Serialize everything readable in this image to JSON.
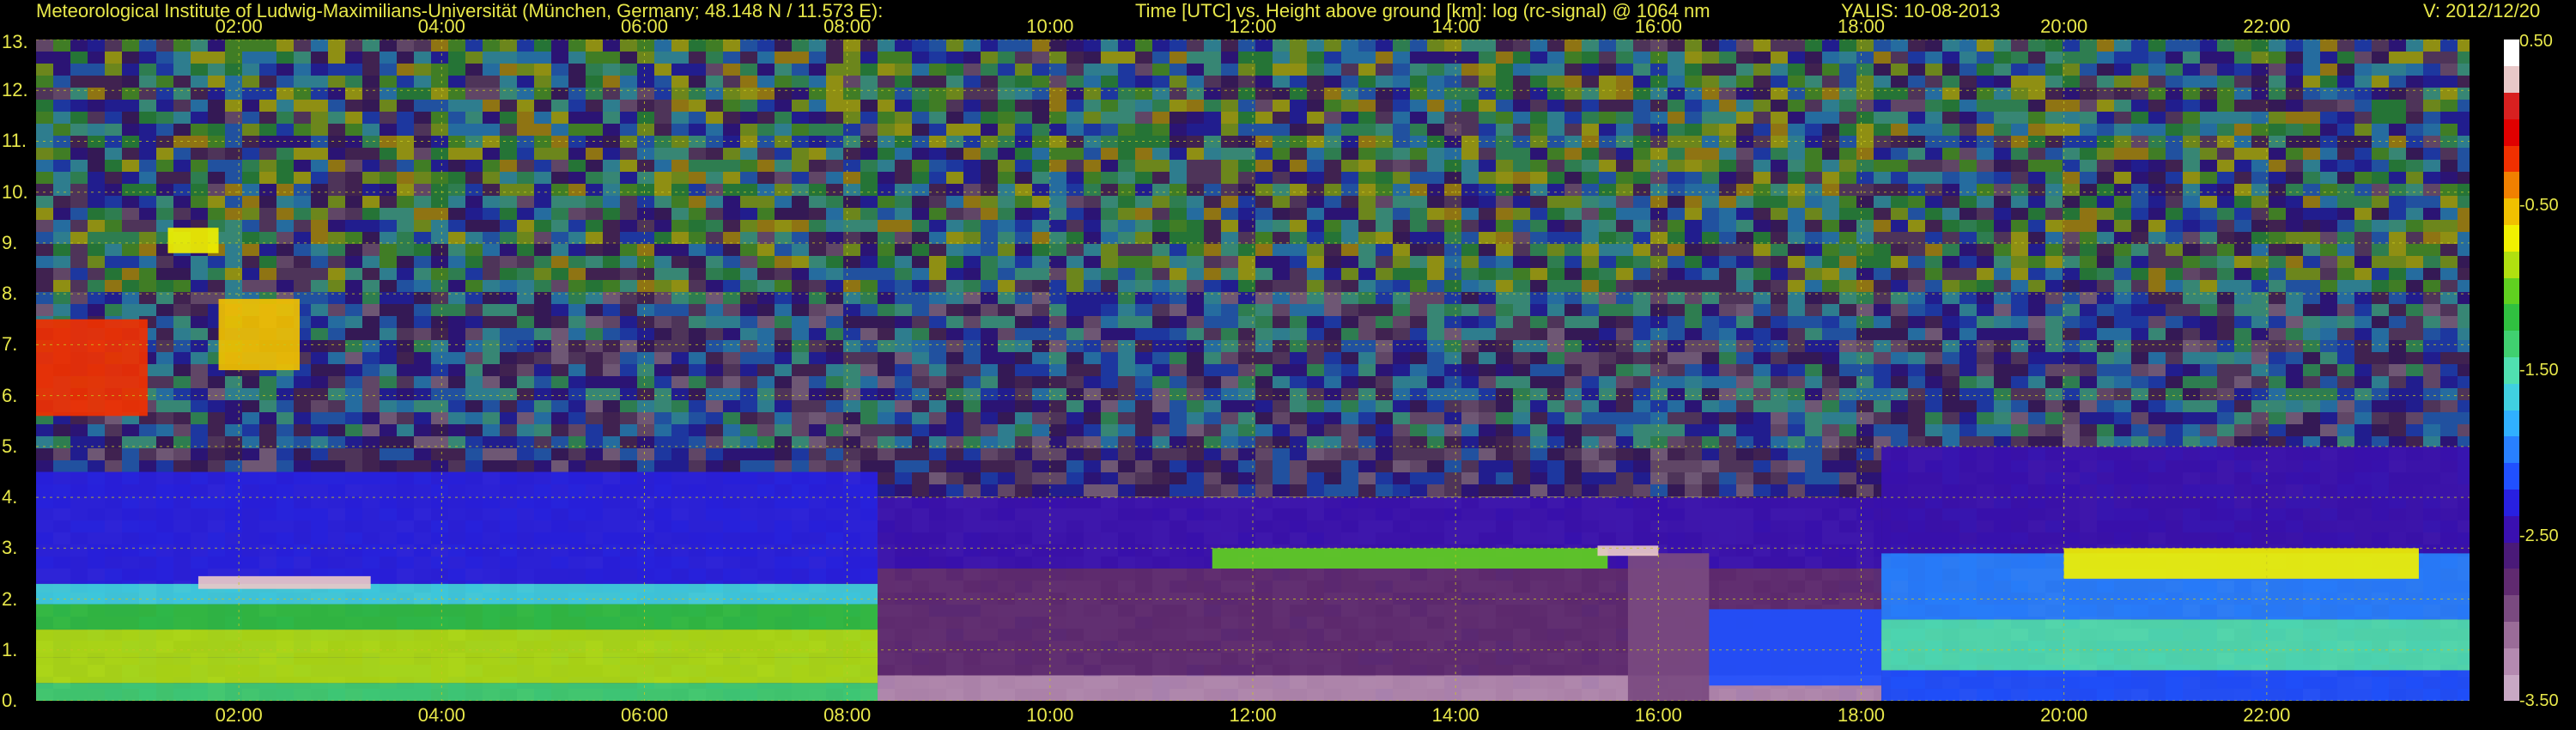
{
  "header": {
    "left": "Meteorological Institute of Ludwig-Maximilians-Universität (München, Germany; 48.148 N / 11.573 E):",
    "center": "Time [UTC] vs. Height above ground [km]: log (rc-signal) @ 1064 nm",
    "instrument": "YALIS: 10-08-2013",
    "version": "V: 2012/12/20"
  },
  "colors": {
    "text": "#e8e84a",
    "grid": "#c8c820",
    "background": "#000000"
  },
  "chart_data": {
    "type": "heatmap",
    "title": "Time [UTC] vs. Height above ground [km]: log (rc-signal) @ 1064 nm",
    "xlabel": "Time [UTC]",
    "ylabel": "Height above ground [km]",
    "xlim": [
      0,
      24
    ],
    "ylim": [
      0,
      13
    ],
    "grid": true,
    "x_ticks": [
      {
        "hour": 2,
        "label": "02:00"
      },
      {
        "hour": 4,
        "label": "04:00"
      },
      {
        "hour": 6,
        "label": "06:00"
      },
      {
        "hour": 8,
        "label": "08:00"
      },
      {
        "hour": 10,
        "label": "10:00"
      },
      {
        "hour": 12,
        "label": "12:00"
      },
      {
        "hour": 14,
        "label": "14:00"
      },
      {
        "hour": 16,
        "label": "16:00"
      },
      {
        "hour": 18,
        "label": "18:00"
      },
      {
        "hour": 20,
        "label": "20:00"
      },
      {
        "hour": 22,
        "label": "22:00"
      }
    ],
    "y_ticks": [
      {
        "km": 13,
        "label": "13."
      },
      {
        "km": 12,
        "label": "12."
      },
      {
        "km": 11,
        "label": "11."
      },
      {
        "km": 10,
        "label": "10."
      },
      {
        "km": 9,
        "label": "9."
      },
      {
        "km": 8,
        "label": "8."
      },
      {
        "km": 7,
        "label": "7."
      },
      {
        "km": 6,
        "label": "6."
      },
      {
        "km": 5,
        "label": "5."
      },
      {
        "km": 4,
        "label": "4."
      },
      {
        "km": 3,
        "label": "3."
      },
      {
        "km": 2,
        "label": "2."
      },
      {
        "km": 1,
        "label": "1."
      },
      {
        "km": 0,
        "label": "0."
      }
    ],
    "colorbar": {
      "range": [
        -3.5,
        0.5
      ],
      "ticks": [
        {
          "value": 0.5,
          "label": "0.50"
        },
        {
          "value": -0.5,
          "label": "-0.50"
        },
        {
          "value": -1.5,
          "label": "-1.50"
        },
        {
          "value": -2.5,
          "label": "-2.50"
        },
        {
          "value": -3.5,
          "label": "-3.50"
        }
      ],
      "colors_bottom_to_top": [
        "#c8a8c4",
        "#b48ab0",
        "#9a6c98",
        "#7a4a80",
        "#602a70",
        "#4a1a78",
        "#3a10b0",
        "#2820e0",
        "#2050ff",
        "#2880ff",
        "#30b0ff",
        "#40d0e0",
        "#50e0b0",
        "#40d070",
        "#30c040",
        "#60d020",
        "#b0e010",
        "#f0f000",
        "#f0c000",
        "#f08000",
        "#f03000",
        "#e00000",
        "#d82020",
        "#e8c8c8",
        "#ffffff"
      ]
    },
    "layers": [
      {
        "t0": 0.0,
        "t1": 8.3,
        "h0": 0.0,
        "h1": 0.35,
        "value": -1.3
      },
      {
        "t0": 0.0,
        "t1": 8.3,
        "h0": 0.35,
        "h1": 0.85,
        "value": -0.8
      },
      {
        "t0": 0.0,
        "t1": 8.3,
        "h0": 0.85,
        "h1": 1.4,
        "value": -0.9
      },
      {
        "t0": 0.0,
        "t1": 8.3,
        "h0": 1.4,
        "h1": 1.9,
        "value": -1.2
      },
      {
        "t0": 0.0,
        "t1": 8.3,
        "h0": 1.9,
        "h1": 2.3,
        "value": -1.6
      },
      {
        "t0": 0.0,
        "t1": 8.3,
        "h0": 2.3,
        "h1": 4.5,
        "value": -2.3
      },
      {
        "t0": 8.3,
        "t1": 18.2,
        "h0": 0.0,
        "h1": 0.5,
        "value": -3.3
      },
      {
        "t0": 8.3,
        "t1": 18.2,
        "h0": 0.5,
        "h1": 2.6,
        "value": -2.8
      },
      {
        "t0": 8.3,
        "t1": 18.2,
        "h0": 2.6,
        "h1": 4.0,
        "value": -2.4
      },
      {
        "t0": 15.7,
        "t1": 16.5,
        "h0": 0.0,
        "h1": 2.9,
        "value": -2.9
      },
      {
        "t0": 16.5,
        "t1": 18.2,
        "h0": 0.3,
        "h1": 1.8,
        "value": -2.2
      },
      {
        "t0": 18.2,
        "t1": 24.0,
        "h0": 0.0,
        "h1": 0.6,
        "value": -2.1
      },
      {
        "t0": 18.2,
        "t1": 24.0,
        "h0": 0.6,
        "h1": 1.6,
        "value": -1.5
      },
      {
        "t0": 18.2,
        "t1": 24.0,
        "h0": 1.6,
        "h1": 2.9,
        "value": -2.0
      },
      {
        "t0": 18.2,
        "t1": 24.0,
        "h0": 2.9,
        "h1": 5.0,
        "value": -2.5
      },
      {
        "t0": 0.0,
        "t1": 1.1,
        "h0": 5.6,
        "h1": 7.5,
        "value": -0.3
      },
      {
        "t0": 1.3,
        "t1": 1.8,
        "h0": 8.8,
        "h1": 9.3,
        "value": -0.7
      },
      {
        "t0": 1.8,
        "t1": 2.6,
        "h0": 6.5,
        "h1": 7.9,
        "value": -0.5
      },
      {
        "t0": 1.6,
        "t1": 3.3,
        "h0": 2.2,
        "h1": 2.45,
        "value": 0.2
      },
      {
        "t0": 11.6,
        "t1": 15.5,
        "h0": 2.6,
        "h1": 3.0,
        "value": -1.0
      },
      {
        "t0": 15.4,
        "t1": 16.0,
        "h0": 2.85,
        "h1": 3.05,
        "value": 0.3
      },
      {
        "t0": 20.0,
        "t1": 23.5,
        "h0": 2.4,
        "h1": 3.0,
        "value": -0.7
      }
    ],
    "annotations": []
  }
}
